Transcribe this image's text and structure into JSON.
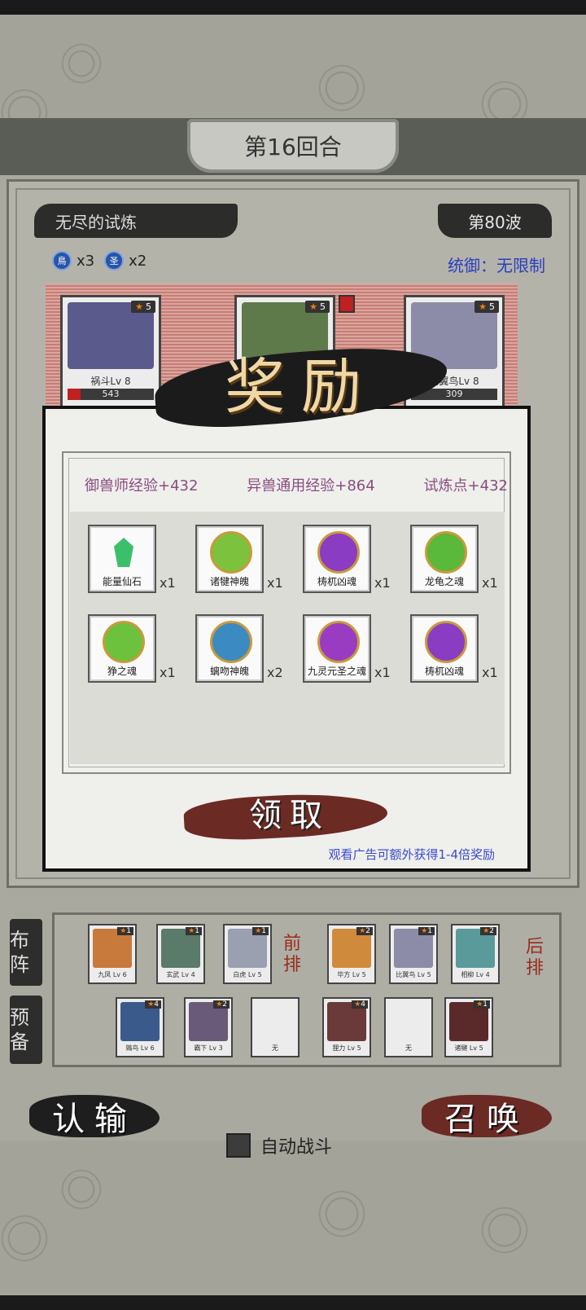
{
  "header": {
    "round_label": "第16回合"
  },
  "stage": {
    "mode": "无尽的试炼",
    "wave": "第80波",
    "command_label": "统御：无限制",
    "elements": [
      {
        "icon": "bird-element-icon",
        "glyph": "鳥",
        "count": "x3"
      },
      {
        "icon": "holy-element-icon",
        "glyph": "圣",
        "count": "x2"
      }
    ]
  },
  "enemies": [
    {
      "name": "祸斗Lv 8",
      "stars": "5",
      "hp_text": "543",
      "hp_fraction": 0.15,
      "color": "#5a5a8c"
    },
    {
      "name": "",
      "stars": "5",
      "hp_text": "",
      "hp_fraction": 1.0,
      "color": "#5e7a4a"
    },
    {
      "name": "比翼鸟Lv 8",
      "stars": "5",
      "hp_text": "309",
      "hp_fraction": 0.0,
      "color": "#8c8ca8"
    }
  ],
  "reward": {
    "title": "奖励",
    "exp": [
      {
        "label": "御兽师经验+432"
      },
      {
        "label": "异兽通用经验+864"
      },
      {
        "label": "试炼点+432"
      }
    ],
    "items": [
      {
        "name": "能量仙石",
        "qty": "x1",
        "kind": "gem",
        "color": "#3cbf6a"
      },
      {
        "name": "诸犍神魄",
        "qty": "x1",
        "kind": "orb",
        "color": "#7cc23c"
      },
      {
        "name": "梼杌凶魂",
        "qty": "x1",
        "kind": "orb",
        "color": "#8a3cc2"
      },
      {
        "name": "龙龟之魂",
        "qty": "x1",
        "kind": "orb",
        "color": "#5ab83a"
      },
      {
        "name": "狰之魂",
        "qty": "x1",
        "kind": "orb",
        "color": "#6cc23c"
      },
      {
        "name": "螭吻神魄",
        "qty": "x2",
        "kind": "orb",
        "color": "#3c8ac2"
      },
      {
        "name": "九灵元圣之魂",
        "qty": "x1",
        "kind": "orb",
        "color": "#9a3cc2"
      },
      {
        "name": "梼杌凶魂",
        "qty": "x1",
        "kind": "orb",
        "color": "#8a3cc2"
      }
    ],
    "claim_label": "领取",
    "ad_note": "观看广告可额外获得1-4倍奖励"
  },
  "formation": {
    "tab_deploy": "布阵",
    "tab_reserve": "预备",
    "front_label": "前排",
    "back_label": "后排",
    "front_row": [
      {
        "name": "九凤 Lv 6",
        "stars": "1",
        "color": "#c87a3c"
      },
      {
        "name": "玄武 Lv 4",
        "stars": "1",
        "color": "#5a7a6a"
      },
      {
        "name": "白虎 Lv 5",
        "stars": "1",
        "color": "#9aa0b0"
      }
    ],
    "back_row": [
      {
        "name": "毕方 Lv 5",
        "stars": "2",
        "color": "#d08a3c"
      },
      {
        "name": "比翼鸟 Lv 5",
        "stars": "1",
        "color": "#8c8ca8"
      },
      {
        "name": "相柳 Lv 4",
        "stars": "2",
        "color": "#5a9a9a"
      }
    ],
    "reserve": [
      {
        "name": "鵕鸟 Lv 6",
        "stars": "4",
        "color": "#3a5a8c"
      },
      {
        "name": "霸下 Lv 3",
        "stars": "2",
        "color": "#6a5a7a"
      },
      {
        "name": "无",
        "stars": "",
        "color": ""
      },
      {
        "name": "狸力 Lv 5",
        "stars": "4",
        "color": "#6a3a3a"
      },
      {
        "name": "无",
        "stars": "",
        "color": ""
      },
      {
        "name": "诸犍 Lv 5",
        "stars": "1",
        "color": "#5a2a2a"
      }
    ]
  },
  "footer": {
    "surrender_label": "认输",
    "auto_battle_label": "自动战斗",
    "summon_label": "召唤"
  }
}
